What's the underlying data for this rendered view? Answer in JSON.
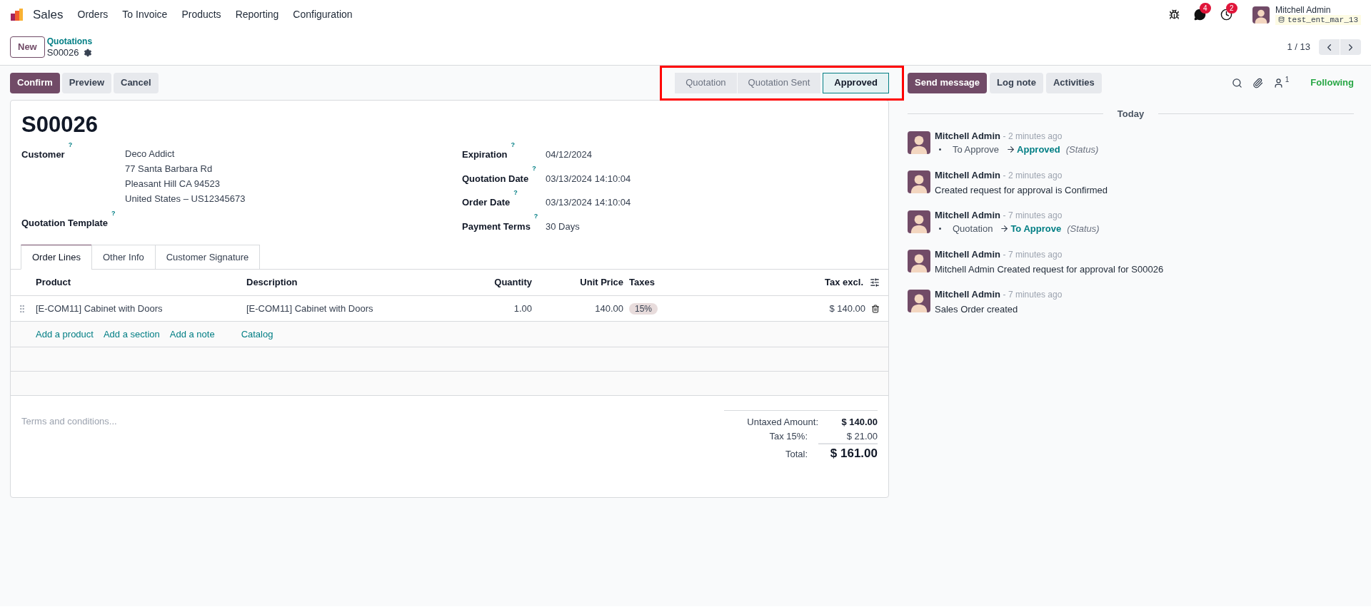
{
  "navbar": {
    "app": "Sales",
    "menu": [
      "Orders",
      "To Invoice",
      "Products",
      "Reporting",
      "Configuration"
    ],
    "messages_badge": "4",
    "activities_badge": "2",
    "user": "Mitchell Admin",
    "database": "test_ent_mar_13"
  },
  "control_panel": {
    "new_button": "New",
    "breadcrumb": "Quotations",
    "record": "S00026",
    "pager": "1 / 13"
  },
  "actions": [
    {
      "label": "Confirm",
      "primary": true
    },
    {
      "label": "Preview",
      "primary": false
    },
    {
      "label": "Cancel",
      "primary": false
    }
  ],
  "status_bar": [
    {
      "label": "Quotation",
      "selected": false
    },
    {
      "label": "Quotation Sent",
      "selected": false
    },
    {
      "label": "Approved",
      "selected": true
    }
  ],
  "form": {
    "title": "S00026",
    "left_fields": [
      {
        "label": "Customer",
        "help": "?",
        "lines": [
          "Deco Addict",
          "77 Santa Barbara Rd",
          "Pleasant Hill CA 94523",
          "United States – US12345673"
        ]
      },
      {
        "label": "Quotation Template",
        "help": "?"
      }
    ],
    "right_fields": [
      {
        "label": "Expiration",
        "help": "?",
        "value": "04/12/2024"
      },
      {
        "label": "Quotation Date",
        "help": "?",
        "value": "03/13/2024 14:10:04"
      },
      {
        "label": "Order Date",
        "help": "?",
        "value": "03/13/2024 14:10:04"
      },
      {
        "label": "Payment Terms",
        "help": "?",
        "value": "30 Days"
      }
    ],
    "tabs": [
      {
        "label": "Order Lines",
        "selected": true
      },
      {
        "label": "Other Info",
        "selected": false
      },
      {
        "label": "Customer Signature",
        "selected": false
      }
    ],
    "table": {
      "columns": [
        "Product",
        "Description",
        "Quantity",
        "Unit Price",
        "Taxes",
        "Tax excl."
      ],
      "rows": [
        {
          "product": "[E-COM11] Cabinet with Doors",
          "description": "[E-COM11] Cabinet with Doors",
          "quantity": "1.00",
          "unit_price": "140.00",
          "taxes": "15%",
          "tax_excl": "$ 140.00"
        }
      ],
      "add_links": [
        "Add a product",
        "Add a section",
        "Add a note",
        "Catalog"
      ]
    },
    "terms_placeholder": "Terms and conditions...",
    "totals": [
      {
        "label": "Untaxed Amount:",
        "value": "$ 140.00",
        "kind": "bold"
      },
      {
        "label": "Tax 15%:",
        "value": "$ 21.00",
        "kind": "normal"
      },
      {
        "label": "Total:",
        "value": "$ 161.00",
        "kind": "grand"
      }
    ]
  },
  "chatter": {
    "buttons": [
      {
        "label": "Send message",
        "primary": true
      },
      {
        "label": "Log note",
        "primary": false
      },
      {
        "label": "Activities",
        "primary": false
      }
    ],
    "followers_count": "1",
    "following": "Following",
    "date_separator": "Today",
    "messages": [
      {
        "author": "Mitchell Admin",
        "time": "- 2 minutes ago",
        "kind": "tracking",
        "old": "To Approve",
        "new": "Approved",
        "field": "(Status)"
      },
      {
        "author": "Mitchell Admin",
        "time": "- 2 minutes ago",
        "kind": "text",
        "body": "Created request for approval is Confirmed"
      },
      {
        "author": "Mitchell Admin",
        "time": "- 7 minutes ago",
        "kind": "tracking",
        "old": "Quotation",
        "new": "To Approve",
        "field": "(Status)"
      },
      {
        "author": "Mitchell Admin",
        "time": "- 7 minutes ago",
        "kind": "text",
        "body": "Mitchell Admin Created request for approval for S00026"
      },
      {
        "author": "Mitchell Admin",
        "time": "- 7 minutes ago",
        "kind": "text",
        "body": "Sales Order created"
      }
    ]
  }
}
